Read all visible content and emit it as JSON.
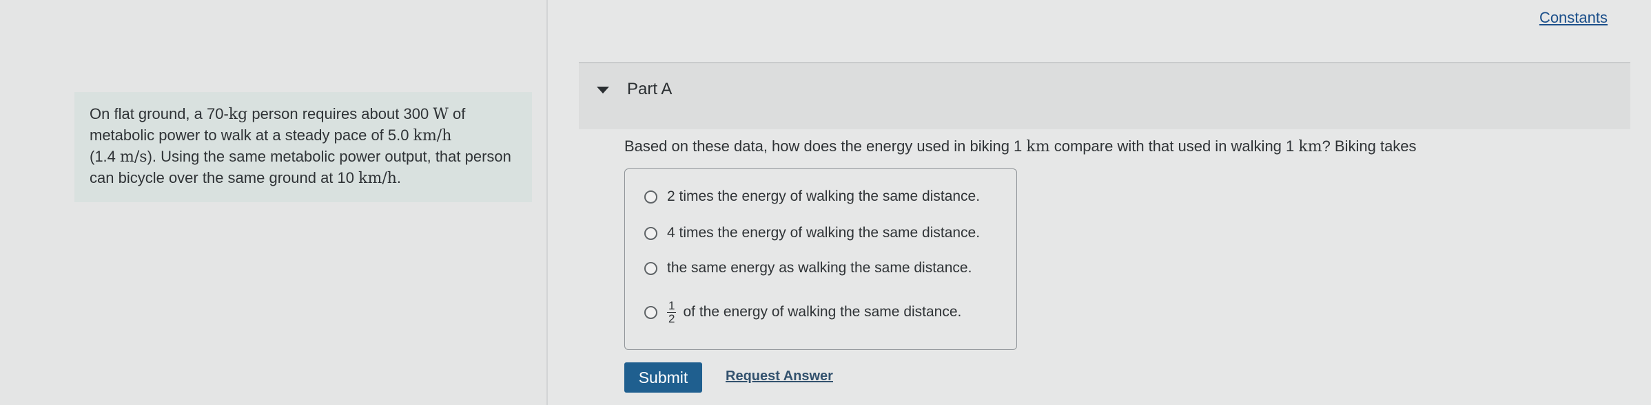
{
  "problem": {
    "parts": [
      "On flat ground, a 70-",
      "kg",
      " person requires about 300 ",
      "W",
      " of metabolic power to walk at a steady pace of 5.0 ",
      "km/h",
      " (1.4 ",
      "m/s",
      "). Using the same metabolic power output, that person can bicycle over the same ground at 10 ",
      "km/h",
      "."
    ]
  },
  "header": {
    "constants_link": "Constants"
  },
  "part": {
    "title": "Part A"
  },
  "question": {
    "before": "Based on these data, how does the energy used in biking 1 ",
    "unit1": "km",
    "middle": " compare with that used in walking 1 ",
    "unit2": "km",
    "after": "? Biking takes"
  },
  "choices": [
    {
      "label": "2 times the energy of walking the same distance."
    },
    {
      "label": "4 times the energy of walking the same distance."
    },
    {
      "label": "the same energy as walking the same distance."
    },
    {
      "numerator": "1",
      "denominator": "2",
      "label": "of the energy of walking the same distance."
    }
  ],
  "actions": {
    "submit_label": "Submit",
    "request_answer_label": "Request Answer"
  }
}
